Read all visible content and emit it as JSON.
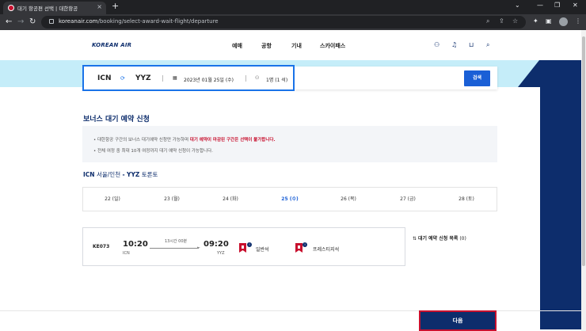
{
  "browser": {
    "tab_title": "대기 항공편 선택 | 대한항공",
    "tab_close": "×",
    "new_tab": "+",
    "url_domain": "koreanair.com",
    "url_path": "/booking/select-award-wait-flight/departure",
    "window_controls": [
      "⌄",
      "—",
      "❐",
      "✕"
    ]
  },
  "header": {
    "logo_text": "KOREAN AIR",
    "nav": [
      "예매",
      "공항",
      "기내",
      "스카이패스"
    ]
  },
  "search": {
    "origin": "ICN",
    "destination": "YYZ",
    "date": "2023년 01월 25일 (수)",
    "passengers": "1명 (1 석)",
    "search_button": "검색"
  },
  "main": {
    "title": "보너스 대기 예약 신청",
    "notice": {
      "line1_prefix": "대한항공 구간의 보너스 대기예약 신청만 가능하며 ",
      "line1_emphasis": "대기 예약이 마감된 구간은 선택이 불가합니다.",
      "line2": "전체 여정 중 최대 10개 여정까지 대기 예약 신청이 가능합니다."
    },
    "route": {
      "origin_code": "ICN",
      "origin_city": "서울/인천",
      "separator": "-",
      "dest_code": "YYZ",
      "dest_city": "토론토"
    },
    "dates": [
      "22 (일)",
      "23 (월)",
      "24 (화)",
      "25 (수)",
      "26 (목)",
      "27 (금)",
      "28 (토)"
    ],
    "active_date": "25 (수)",
    "flight": {
      "number": "KE073",
      "dep_time": "10:20",
      "dep_code": "ICN",
      "duration": "13시간 00분",
      "arr_time": "09:20",
      "arr_code": "YYZ",
      "classes": [
        "일반석",
        "프레스티지석"
      ]
    },
    "waitlist": {
      "label": "대기 예약 신청 목록",
      "count": "(0)"
    },
    "next_button": "다음"
  },
  "colors": {
    "brand_navy": "#0d2d6c",
    "brand_red": "#c8102e",
    "accent_blue": "#1a5fd6",
    "band_sky": "#c5edf9"
  }
}
